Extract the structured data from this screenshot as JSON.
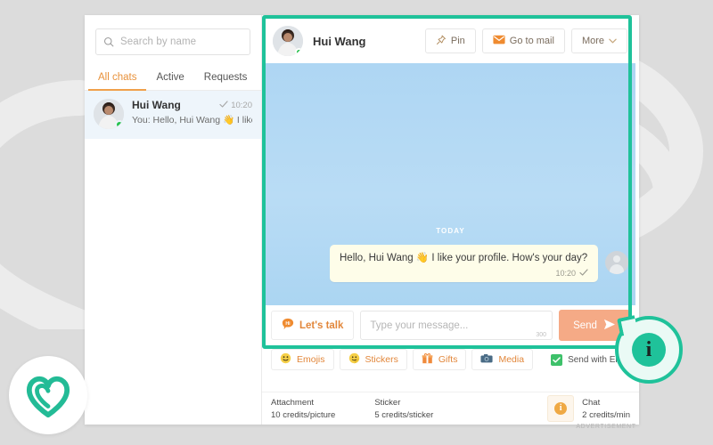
{
  "search": {
    "placeholder": "Search by name",
    "icon": "search-icon"
  },
  "tabs": [
    {
      "label": "All chats",
      "active": true
    },
    {
      "label": "Active",
      "active": false
    },
    {
      "label": "Requests",
      "active": false
    }
  ],
  "conversation": {
    "name": "Hui Wang",
    "preview": "You: Hello, Hui Wang 👋 I like",
    "time": "10:20",
    "status_icon": "check-icon",
    "online": true
  },
  "chat_header": {
    "name": "Hui Wang",
    "buttons": [
      {
        "label": "Pin",
        "icon": "pin-icon"
      },
      {
        "label": "Go to mail",
        "icon": "mail-icon"
      },
      {
        "label": "More",
        "icon": "chevron-down-icon"
      }
    ]
  },
  "messages": {
    "day_divider": "TODAY",
    "items": [
      {
        "text": "Hello, Hui Wang 👋 I like your profile. How's your day?",
        "time": "10:20",
        "status_icon": "check-icon",
        "outgoing": true
      }
    ]
  },
  "composer": {
    "lets_talk_label": "Let's talk",
    "lets_talk_icon": "hi-bubble-icon",
    "input_placeholder": "Type your message...",
    "input_value": "",
    "char_count": "300",
    "send_label": "Send",
    "send_icon": "paper-plane-icon"
  },
  "actions": [
    {
      "label": "Emojis",
      "icon": "emoji-icon"
    },
    {
      "label": "Stickers",
      "icon": "sticker-icon"
    },
    {
      "label": "Gifts",
      "icon": "gift-icon"
    },
    {
      "label": "Media",
      "icon": "camera-icon"
    }
  ],
  "send_with_enter": {
    "label": "Send with Ent",
    "checked": true
  },
  "pricing": [
    {
      "title": "Attachment",
      "value": "10 credits/picture"
    },
    {
      "title": "Sticker",
      "value": "5 credits/sticker"
    }
  ],
  "chat_pricing": {
    "title": "Chat",
    "value": "2 credits/min",
    "icon": "info-icon"
  },
  "badge": {
    "icon": "info-icon",
    "glyph": "i"
  },
  "brand": {
    "icon": "heart-logo-icon"
  },
  "footer": {
    "advertisement_label": "ADVERTISEMENT"
  },
  "colors": {
    "teal": "#1fc29a",
    "orange": "#e2873b",
    "salmon": "#f5aa86",
    "green": "#3ec16a",
    "chat_bg_top": "#aed6f3",
    "bubble": "#fefde9"
  }
}
